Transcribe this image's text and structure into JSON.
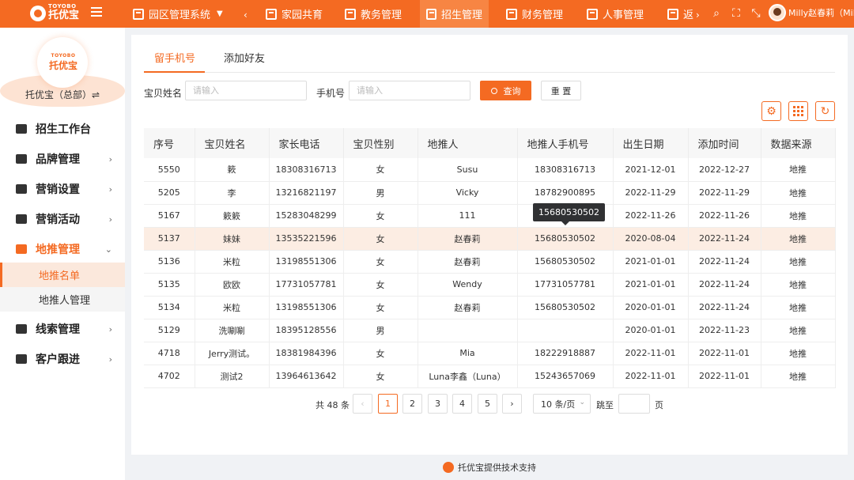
{
  "topbar": {
    "logo_en": "TOYOBO",
    "logo_cn": "托优宝",
    "system_label": "园区管理系统",
    "nav": [
      "家园共育",
      "教务管理",
      "招生管理",
      "财务管理",
      "人事管理",
      "返"
    ],
    "user_name": "Milly赵春莉（Mill"
  },
  "sidebar": {
    "brand_en": "TOYOBO",
    "brand_cn": "托优宝",
    "org_name": "托优宝（总部）⇌",
    "items": [
      {
        "label": "招生工作台"
      },
      {
        "label": "品牌管理"
      },
      {
        "label": "营销设置"
      },
      {
        "label": "营销活动"
      },
      {
        "label": "地推管理"
      },
      {
        "label": "线索管理"
      },
      {
        "label": "客户跟进"
      }
    ],
    "sub_items": [
      {
        "label": "地推名单"
      },
      {
        "label": "地推人管理"
      }
    ]
  },
  "tabs": [
    "留手机号",
    "添加好友"
  ],
  "filters": {
    "name_label": "宝贝姓名",
    "name_placeholder": "请输入",
    "phone_label": "手机号",
    "phone_placeholder": "请输入",
    "search_label": "查询",
    "reset_label": "重 置"
  },
  "table": {
    "headers": [
      "序号",
      "宝贝姓名",
      "家长电话",
      "宝贝性别",
      "地推人",
      "地推人手机号",
      "出生日期",
      "添加时间",
      "数据来源"
    ],
    "rows": [
      [
        "5550",
        "簌",
        "18308316713",
        "女",
        "Susu",
        "18308316713",
        "2021-12-01",
        "2022-12-27",
        "地推"
      ],
      [
        "5205",
        "李",
        "13216821197",
        "男",
        "Vicky",
        "18782900895",
        "2022-11-29",
        "2022-11-29",
        "地推"
      ],
      [
        "5167",
        "簌簌",
        "15283048299",
        "女",
        "111",
        "15680530502",
        "2022-11-26",
        "2022-11-26",
        "地推"
      ],
      [
        "5137",
        "妹妹",
        "13535221596",
        "女",
        "赵春莉",
        "15680530502",
        "2020-08-04",
        "2022-11-24",
        "地推"
      ],
      [
        "5136",
        "米粒",
        "13198551306",
        "女",
        "赵春莉",
        "15680530502",
        "2021-01-01",
        "2022-11-24",
        "地推"
      ],
      [
        "5135",
        "欧欧",
        "17731057781",
        "女",
        "Wendy",
        "17731057781",
        "2021-01-01",
        "2022-11-24",
        "地推"
      ],
      [
        "5134",
        "米粒",
        "13198551306",
        "女",
        "赵春莉",
        "15680530502",
        "2020-01-01",
        "2022-11-24",
        "地推"
      ],
      [
        "5129",
        "洗唰唰",
        "18395128556",
        "男",
        "",
        "",
        "2020-01-01",
        "2022-11-23",
        "地推"
      ],
      [
        "4718",
        "Jerry测试。",
        "18381984396",
        "女",
        "Mia",
        "18222918887",
        "2022-11-01",
        "2022-11-01",
        "地推"
      ],
      [
        "4702",
        "测试2",
        "13964613642",
        "女",
        "Luna李鑫（Luna）",
        "15243657069",
        "2022-11-01",
        "2022-11-01",
        "地推"
      ]
    ],
    "highlight_row": 3,
    "tooltip": "15680530502"
  },
  "pagination": {
    "total": "共 48 条",
    "pages": [
      "1",
      "2",
      "3",
      "4",
      "5"
    ],
    "current": "1",
    "page_size": "10 条/页",
    "jump_label": "跳至",
    "page_label": "页"
  },
  "footer": "托优宝提供技术支持",
  "colors": {
    "accent": "#f46a22",
    "highlight_row": "#fcede3"
  }
}
